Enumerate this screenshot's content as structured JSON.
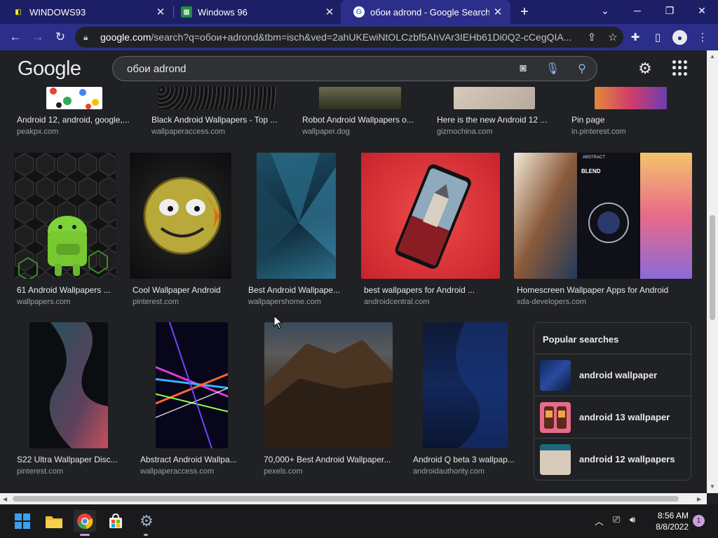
{
  "tabs": [
    {
      "title": "WINDOWS93",
      "favicon": "windows93-favicon"
    },
    {
      "title": "Windows 96",
      "favicon": "windows96-favicon"
    },
    {
      "title": "обои adrond - Google Search",
      "favicon": "google-favicon"
    }
  ],
  "url": {
    "host": "google.com",
    "path": "/search?q=обои+adrond&tbm=isch&ved=2ahUKEwiNtOLCzbf5AhVAr3IEHb61Di0Q2-cCegQIA..."
  },
  "google": {
    "logo": "Google",
    "query": "обои adrond"
  },
  "top_row": [
    {
      "caption": "Android 12, android, google,...",
      "source": "peakpx.com"
    },
    {
      "caption": "Black Android Wallpapers - Top ...",
      "source": "wallpaperaccess.com"
    },
    {
      "caption": "Robot Android Wallpapers o...",
      "source": "wallpaper.dog"
    },
    {
      "caption": "Here is the new Android 12 ...",
      "source": "gizmochina.com"
    },
    {
      "caption": "Pin page",
      "source": "in.pinterest.com"
    }
  ],
  "middle_row": [
    {
      "caption": "61 Android Wallpapers ...",
      "source": "wallpapers.com"
    },
    {
      "caption": "Cool Wallpaper Android",
      "source": "pinterest.com"
    },
    {
      "caption": "Best Android Wallpape...",
      "source": "wallpapershome.com"
    },
    {
      "caption": "best wallpapers for Android ...",
      "source": "androidcentral.com"
    },
    {
      "caption": "Homescreen Wallpaper Apps for Android",
      "source": "xda-developers.com"
    }
  ],
  "bottom_row": [
    {
      "caption": "S22 Ultra Wallpaper Disc...",
      "source": "pinterest.com"
    },
    {
      "caption": "Abstract Android Wallpa...",
      "source": "wallpaperaccess.com"
    },
    {
      "caption": "70,000+ Best Android Wallpaper...",
      "source": "pexels.com"
    },
    {
      "caption": "Android Q beta 3 wallpap...",
      "source": "androidauthority.com"
    }
  ],
  "popular": {
    "title": "Popular searches",
    "items": [
      {
        "label": "android wallpaper"
      },
      {
        "label": "android 13 wallpaper"
      },
      {
        "label": "android 12 wallpapers"
      }
    ]
  },
  "image_text": {
    "blend": "BLEND",
    "abstract": "ABSTRACT"
  },
  "taskbar": {
    "time": "8:56 AM",
    "date": "8/8/2022",
    "notifications": "1"
  }
}
